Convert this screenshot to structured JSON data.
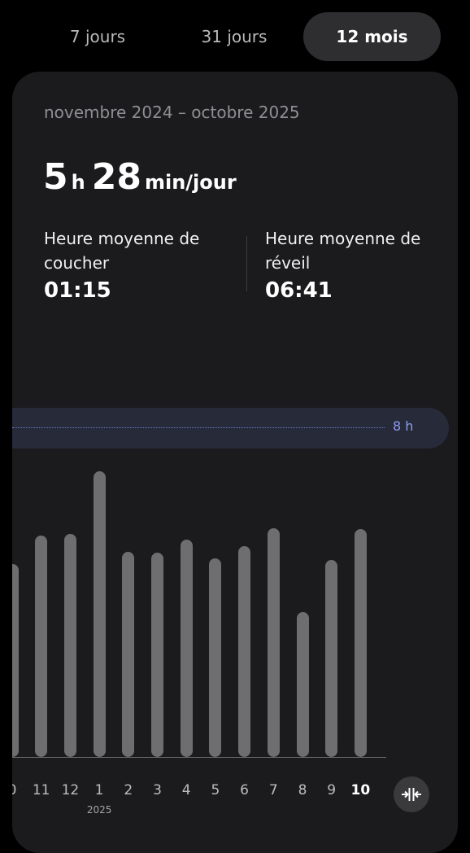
{
  "tabs": [
    {
      "label": "7 jours",
      "selected": false
    },
    {
      "label": "31 jours",
      "selected": false
    },
    {
      "label": "12 mois",
      "selected": true
    }
  ],
  "summary": {
    "period": "novembre 2024 – octobre 2025",
    "avg_hours": "5",
    "hours_unit": "h",
    "avg_minutes": "28",
    "minutes_unit": "min/jour",
    "bedtime_label": "Heure moyenne de coucher",
    "bedtime_value": "01:15",
    "wake_label": "Heure moyenne de réveil",
    "wake_value": "06:41"
  },
  "goal": {
    "label": "8 h",
    "hours": 8
  },
  "chart_data": {
    "type": "bar",
    "categories": [
      "0",
      "11",
      "12",
      "1",
      "2",
      "3",
      "4",
      "5",
      "6",
      "7",
      "8",
      "9",
      "10"
    ],
    "year_label": "2025",
    "year_label_index": 3,
    "active_index": 12,
    "values": [
      5.4,
      6.2,
      6.25,
      8.0,
      5.75,
      5.72,
      6.1,
      5.57,
      5.9,
      6.4,
      4.05,
      5.53,
      6.38
    ],
    "ylim": [
      0,
      8.35
    ],
    "goal_line": 8,
    "unit": "h",
    "bar_color": "#6e6e70",
    "goal_color": "#8e9bf0"
  },
  "controls": {
    "zoom_icon": "collapse-horizontal-icon"
  }
}
